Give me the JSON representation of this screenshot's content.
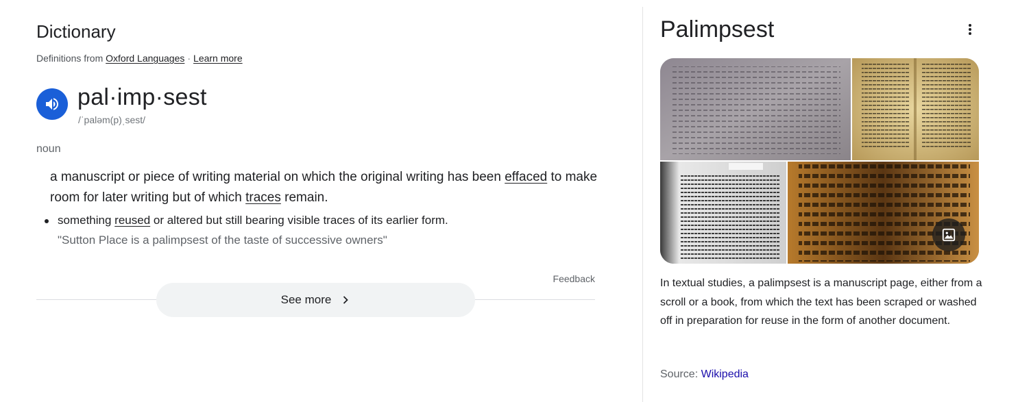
{
  "dictionary": {
    "title": "Dictionary",
    "source_prefix": "Definitions from",
    "source_link": "Oxford Languages",
    "separator": "·",
    "learn_more": "Learn more",
    "headword": "pal·imp·sest",
    "pronunciation": "/ˈpaləm(p)ˌsest/",
    "part_of_speech": "noun",
    "definition": {
      "part1": "a manuscript or piece of writing material on which the original writing has been ",
      "link1": "effaced",
      "part2": " to make room for later writing but of which ",
      "link2": "traces",
      "part3": " remain."
    },
    "sub_definition": {
      "part1": "something ",
      "link1": "reused",
      "part2": " or altered but still bearing visible traces of its earlier form."
    },
    "example": "\"Sutton Place is a palimpsest of the taste of successive owners\"",
    "feedback": "Feedback",
    "see_more": "See more",
    "icons": {
      "speaker": "speaker-icon",
      "chevron": "chevron-right-icon"
    },
    "accent_color": "#1a5fd8"
  },
  "knowledge_panel": {
    "title": "Palimpsest",
    "menu_icon": "more-vert-icon",
    "images": [
      "manuscript-image-1",
      "manuscript-image-2",
      "manuscript-image-3",
      "manuscript-image-4"
    ],
    "image_button_icon": "image-icon",
    "description": "In textual studies, a palimpsest is a manuscript page, either from a scroll or a book, from which the text has been scraped or washed off in preparation for reuse in the form of another document.",
    "source_label": "Source:",
    "source_link": "Wikipedia",
    "link_color": "#1a0dab"
  }
}
